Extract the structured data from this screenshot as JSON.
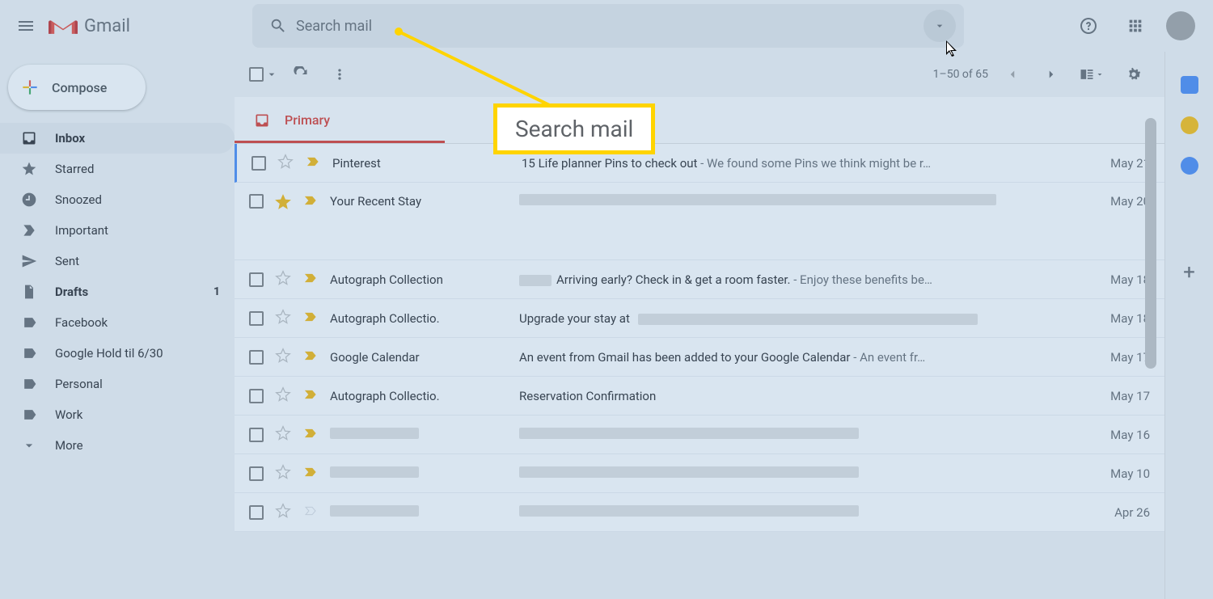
{
  "app_name": "Gmail",
  "search": {
    "placeholder": "Search mail"
  },
  "compose": {
    "label": "Compose"
  },
  "sidebar_items": [
    {
      "label": "Inbox",
      "icon": "inbox",
      "active": true,
      "badge": ""
    },
    {
      "label": "Starred",
      "icon": "star",
      "active": false,
      "badge": ""
    },
    {
      "label": "Snoozed",
      "icon": "clock",
      "active": false,
      "badge": ""
    },
    {
      "label": "Important",
      "icon": "important",
      "active": false,
      "badge": ""
    },
    {
      "label": "Sent",
      "icon": "sent",
      "active": false,
      "badge": ""
    },
    {
      "label": "Drafts",
      "icon": "draft",
      "active": false,
      "badge": "1"
    },
    {
      "label": "Facebook",
      "icon": "label",
      "active": false,
      "badge": ""
    },
    {
      "label": "Google Hold til 6/30",
      "icon": "label",
      "active": false,
      "badge": ""
    },
    {
      "label": "Personal",
      "icon": "label",
      "active": false,
      "badge": ""
    },
    {
      "label": "Work",
      "icon": "label",
      "active": false,
      "badge": ""
    },
    {
      "label": "More",
      "icon": "more",
      "active": false,
      "badge": ""
    }
  ],
  "toolbar": {
    "range": "1–50 of 65"
  },
  "tabs": [
    {
      "label": "Primary",
      "active": true
    }
  ],
  "emails": [
    {
      "sender": "Pinterest",
      "subject": "15 Life planner Pins to check out",
      "preview": " - We found some Pins we think might be r…",
      "date": "May 21",
      "starred": false,
      "imp_filled": true,
      "redact_sender": false,
      "redact_subj": false,
      "tall": false
    },
    {
      "sender": "Your Recent Stay",
      "subject": "",
      "preview": "",
      "date": "May 20",
      "starred": true,
      "imp_filled": true,
      "redact_sender": false,
      "redact_subj": true,
      "tall": true
    },
    {
      "sender": "Autograph Collection",
      "subject": "Arriving early? Check in & get a room faster.",
      "preview": " - Enjoy these benefits be…",
      "date": "May 18",
      "starred": false,
      "imp_filled": true,
      "redact_sender": false,
      "redact_subj": false,
      "redact_prefix": true,
      "tall": false
    },
    {
      "sender": "Autograph Collectio.",
      "subject": "Upgrade your stay at ",
      "preview": "",
      "date": "May 18",
      "starred": false,
      "imp_filled": true,
      "redact_sender": false,
      "redact_subj": false,
      "redact_suffix": true,
      "tall": false
    },
    {
      "sender": "Google Calendar",
      "subject": "An event from Gmail has been added to your Google Calendar",
      "preview": " - An event fr…",
      "date": "May 17",
      "starred": false,
      "imp_filled": true,
      "redact_sender": false,
      "redact_subj": false,
      "tall": false
    },
    {
      "sender": "Autograph Collectio.",
      "subject": "Reservation Confirmation",
      "preview": "",
      "date": "May 17",
      "starred": false,
      "imp_filled": true,
      "redact_sender": false,
      "redact_subj": false,
      "tall": false
    },
    {
      "sender": "",
      "subject": "",
      "preview": "",
      "date": "May 16",
      "starred": false,
      "imp_filled": true,
      "redact_sender": true,
      "redact_subj": true,
      "tall": false
    },
    {
      "sender": "",
      "subject": "",
      "preview": "",
      "date": "May 10",
      "starred": false,
      "imp_filled": true,
      "redact_sender": true,
      "redact_subj": true,
      "tall": false
    },
    {
      "sender": "",
      "subject": "",
      "preview": "",
      "date": "Apr 26",
      "starred": false,
      "imp_filled": false,
      "redact_sender": true,
      "redact_subj": true,
      "tall": false
    }
  ],
  "callout": {
    "text": "Search mail"
  }
}
